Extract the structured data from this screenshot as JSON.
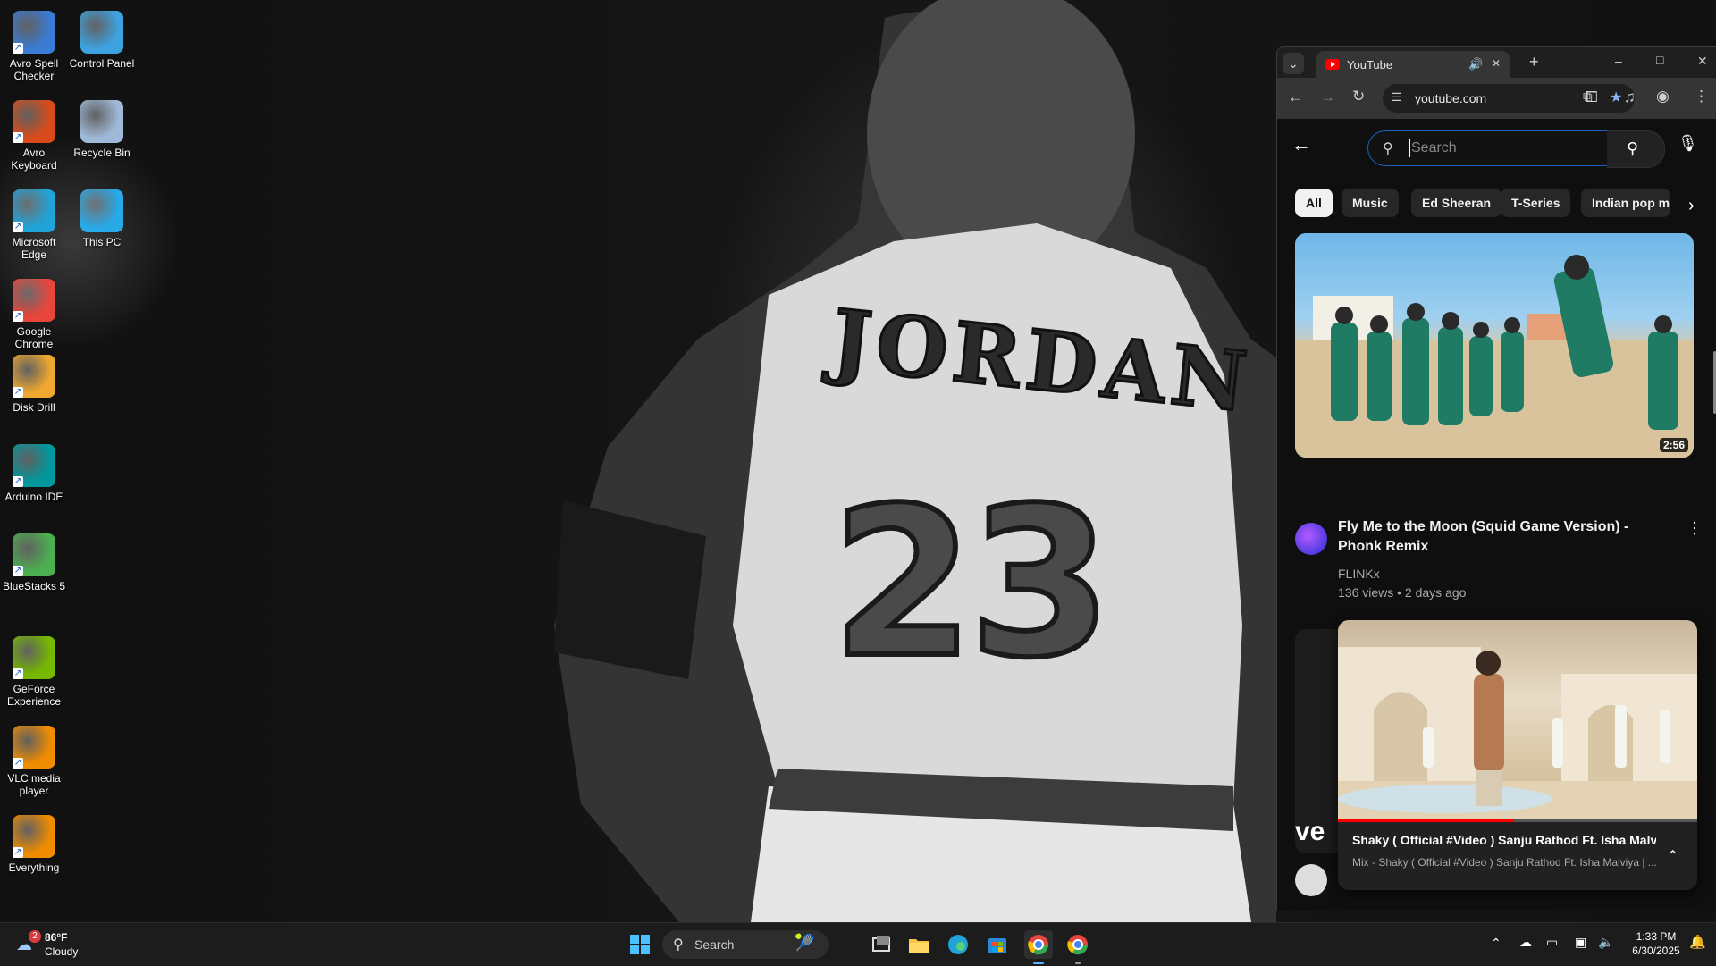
{
  "desktop": {
    "icons": [
      {
        "label": "Avro Spell Checker",
        "icon": "avro-spell-checker-icon",
        "color": "#3a7bd5"
      },
      {
        "label": "Control Panel",
        "icon": "control-panel-icon",
        "color": "#3da2e0"
      },
      {
        "label": "Avro Keyboard",
        "icon": "avro-keyboard-icon",
        "color": "#d94b1a"
      },
      {
        "label": "Recycle Bin",
        "icon": "recycle-bin-icon",
        "color": "#9fb9d8"
      },
      {
        "label": "Microsoft Edge",
        "icon": "edge-icon",
        "color": "#1fa3d8"
      },
      {
        "label": "This PC",
        "icon": "this-pc-icon",
        "color": "#28a9e8"
      },
      {
        "label": "Google Chrome",
        "icon": "chrome-icon",
        "color": "#e8453c"
      },
      {
        "label": "Disk Drill",
        "icon": "disk-drill-icon",
        "color": "#f0a830"
      },
      {
        "label": "Arduino IDE",
        "icon": "arduino-icon",
        "color": "#00979d"
      },
      {
        "label": "BlueStacks 5",
        "icon": "bluestacks-icon",
        "color": "#4caf50"
      },
      {
        "label": "GeForce Experience",
        "icon": "geforce-icon",
        "color": "#76b900"
      },
      {
        "label": "VLC media player",
        "icon": "vlc-icon",
        "color": "#f08c00"
      },
      {
        "label": "Everything",
        "icon": "everything-icon",
        "color": "#f08c00"
      }
    ]
  },
  "browser": {
    "tab_title": "YouTube",
    "url": "youtube.com",
    "new_tab": "+",
    "window_minimize": "–",
    "window_maximize": "□",
    "window_close": "✕",
    "tab_close": "✕"
  },
  "youtube": {
    "search_placeholder": "Search",
    "chips": [
      "All",
      "Music",
      "Ed Sheeran",
      "T-Series",
      "Indian pop mu"
    ],
    "videos": [
      {
        "title": "Fly Me to the Moon (Squid Game Version) - Phonk Remix",
        "channel": "FLINKx",
        "meta": "136 views • 2 days ago",
        "duration": "2:56"
      }
    ],
    "partial_thumb_text": "ve",
    "mini_player": {
      "title": "Shaky ( Official #Video ) Sanju Rathod Ft. Isha Malvi...",
      "subtitle": "Mix - Shaky ( Official #Video ) Sanju Rathod Ft. Isha Malviya | ...",
      "progress": 0.49
    }
  },
  "taskbar": {
    "weather_temp": "86°F",
    "weather_desc": "Cloudy",
    "weather_badge": "2",
    "search_label": "Search",
    "time": "1:33 PM",
    "date": "6/30/2025"
  },
  "colors": {
    "youtube_red": "#ff0000",
    "search_focus": "#1c62b9",
    "taskbar": "#1c1c1c"
  }
}
